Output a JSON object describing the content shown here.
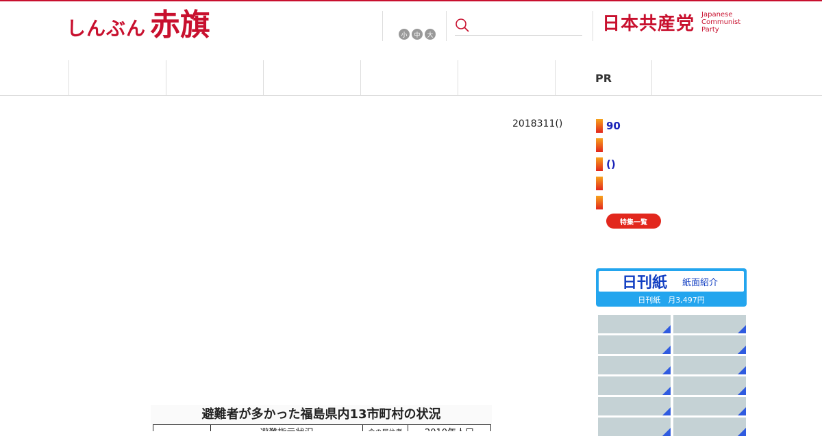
{
  "header": {
    "logo_kana": "しんぶん",
    "logo_kanji": "赤旗",
    "font_sizes": [
      "小",
      "中",
      "大"
    ],
    "search_placeholder": "",
    "jcp_name": "日本共産党",
    "jcp_english": [
      "Japanese",
      "Communist",
      "Party"
    ]
  },
  "nav": {
    "items": [
      "",
      "",
      "",
      "",
      "",
      "PR",
      ""
    ]
  },
  "article": {
    "date": "2018311()",
    "figure_title": "避難者が多かった福島県内13市町村の状況",
    "figure_headers": [
      "",
      "避難指示状況",
      "今の居住者",
      "2010年人口"
    ]
  },
  "sidebar": {
    "topics": [
      "90",
      "",
      "()",
      "",
      ""
    ],
    "all_topics_label": "特集一覧",
    "banner_title": "日刊紙",
    "banner_subtitle": "紙面紹介",
    "banner_price": "日刊紙　月3,497円",
    "tile_count": 12
  },
  "colors": {
    "brand_red": "#c8102e",
    "link_blue": "#1a23b8",
    "banner_blue": "#23a5ee"
  }
}
